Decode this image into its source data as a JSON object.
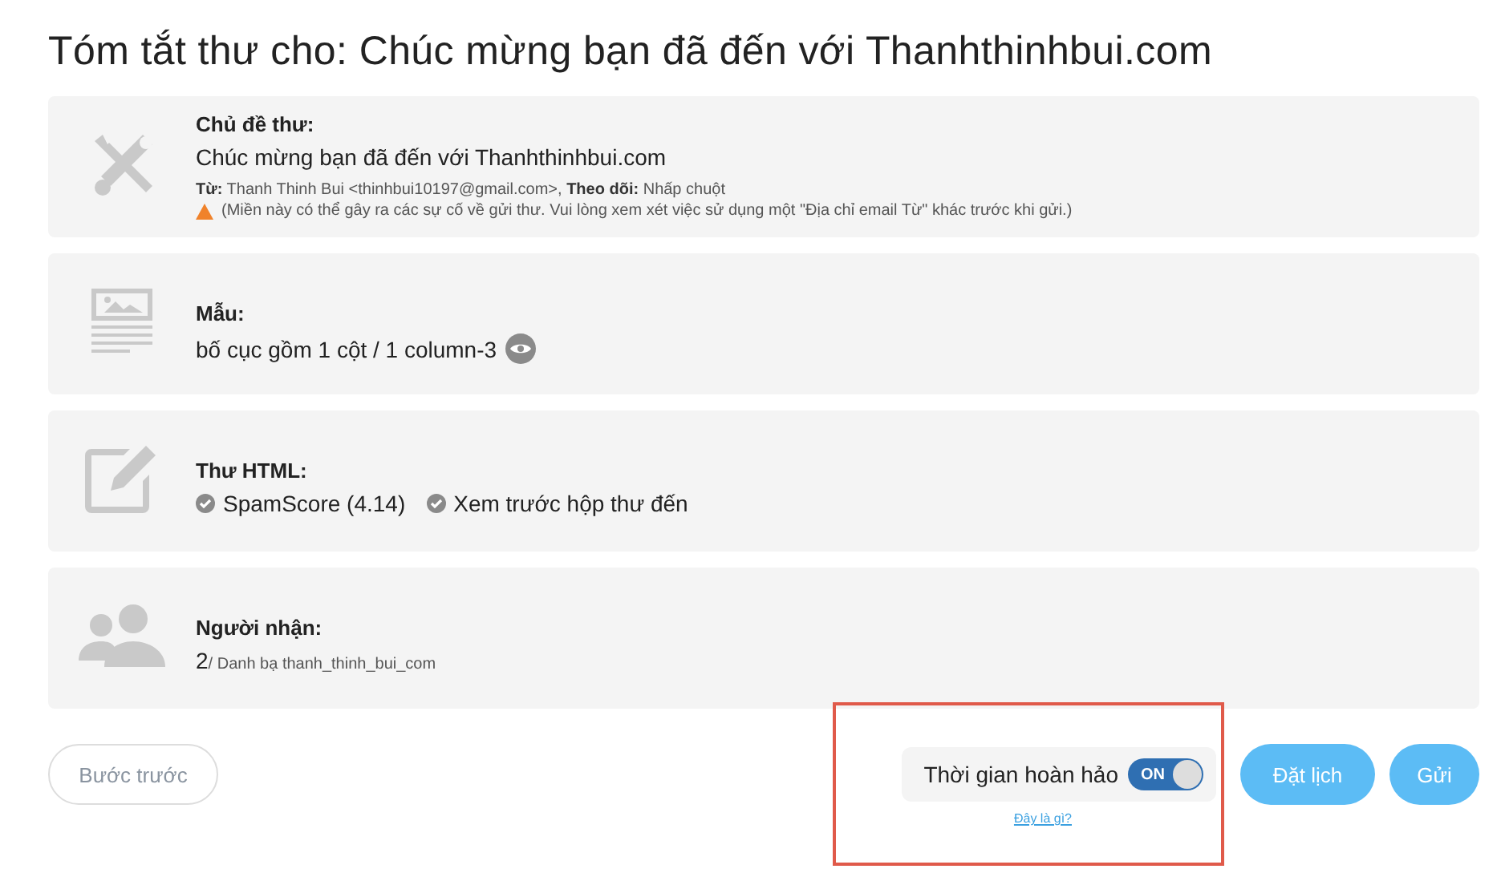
{
  "title": "Tóm tắt thư cho: Chúc mừng bạn đã đến với Thanhthinhbui.com",
  "sections": [
    {
      "kind": "subject",
      "heading": "Chủ đề thư:",
      "value": "Chúc mừng bạn đã đến với Thanhthinhbui.com",
      "from_label": "Từ:",
      "from": "Thanh Thinh Bui <thinhbui10197@gmail.com>,",
      "track_label": "Theo dõi:",
      "track": "Nhấp chuột",
      "warning": "(Miền này có thể gây ra các sự cố về gửi thư. Vui lòng xem xét việc sử dụng một \"Địa chỉ email Từ\" khác trước khi gửi.)"
    },
    {
      "kind": "template",
      "heading": "Mẫu:",
      "value": "bố cục gồm 1 cột / 1 column-3"
    },
    {
      "kind": "html",
      "heading": "Thư HTML:",
      "checks": [
        "SpamScore (4.14)",
        "Xem trước hộp thư đến"
      ]
    },
    {
      "kind": "recipients",
      "heading": "Người nhận:",
      "count": "2",
      "list": "/ Danh bạ thanh_thinh_bui_com"
    }
  ],
  "footer": {
    "back": "Bước trước",
    "perfect_time": {
      "label": "Thời gian hoàn hảo",
      "toggle": "ON",
      "on": true,
      "help": "Đây là gì?"
    },
    "schedule": "Đặt lịch",
    "send": "Gửi"
  }
}
